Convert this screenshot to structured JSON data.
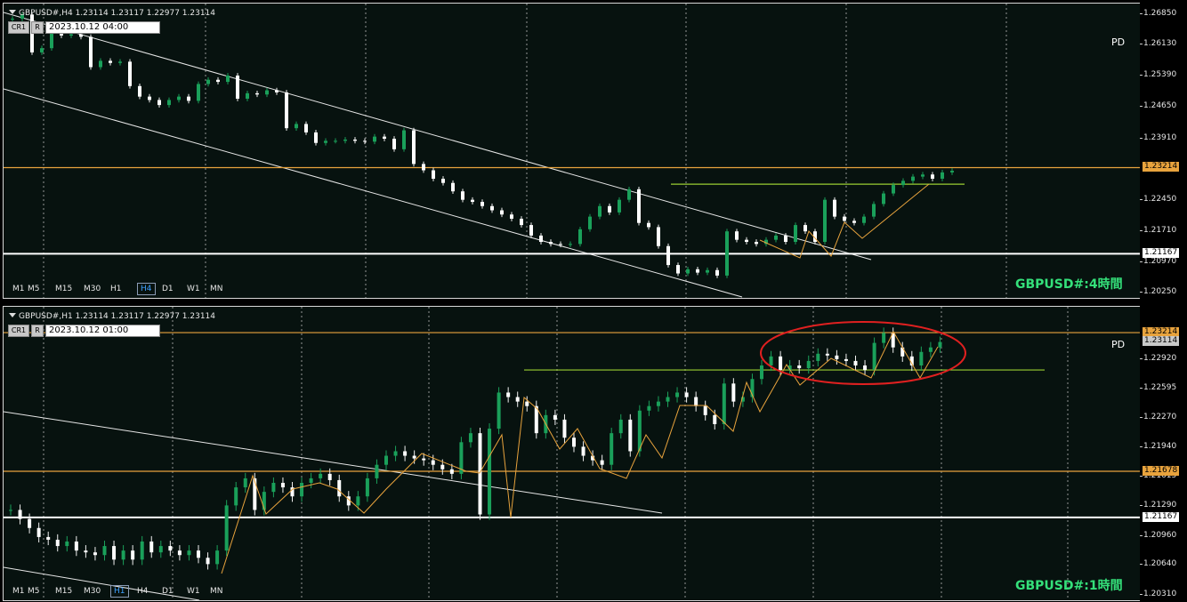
{
  "charts": [
    {
      "header": "GBPUSD#,H4  1.23114 1.23117 1.22977 1.23114",
      "btn1": "CR1",
      "btn2": "R",
      "date": "2023.10.12 04:00",
      "pd": "PD",
      "caption": "GBPUSD#:4時間",
      "timeframes": [
        "M1",
        "M5",
        "M15",
        "M30",
        "H1",
        "H4",
        "D1",
        "W1",
        "MN"
      ],
      "active_tf": "H4",
      "price_labels": [
        {
          "text": "1.23214",
          "value": 1.23214,
          "color": "#e8a33d"
        },
        {
          "text": "1.21167",
          "value": 1.21167,
          "color": "#ffffff"
        }
      ]
    },
    {
      "header": "GBPUSD#,H1  1.23114 1.23117 1.22977 1.23114",
      "btn1": "CR1",
      "btn2": "R",
      "date": "2023.10.12 01:00",
      "pd": "PD",
      "caption": "GBPUSD#:1時間",
      "timeframes": [
        "M1",
        "M5",
        "M15",
        "M30",
        "H1",
        "H4",
        "D1",
        "W1",
        "MN"
      ],
      "active_tf": "H1",
      "price_labels": [
        {
          "text": "1.23214",
          "value": 1.23214,
          "color": "#e8a33d"
        },
        {
          "text": "1.23114",
          "value": 1.23114,
          "color": "#c9c9c9"
        },
        {
          "text": "1.21678",
          "value": 1.21678,
          "color": "#e8a33d"
        },
        {
          "text": "1.21167",
          "value": 1.21167,
          "color": "#ffffff"
        }
      ]
    }
  ],
  "chart_data": [
    {
      "type": "candlestick",
      "symbol": "GBPUSD#",
      "timeframe": "H4",
      "bid": "1.23114",
      "y_ticks": [
        "1.26850",
        "1.26130",
        "1.25390",
        "1.24650",
        "1.23910",
        "1.22450",
        "1.21710",
        "1.20970",
        "1.20250"
      ],
      "ylim": [
        1.2012,
        1.2711
      ],
      "horizontal_lines": [
        {
          "price": 1.23214,
          "color": "#e8a33d"
        },
        {
          "price": 1.21167,
          "color": "#ffffff"
        },
        {
          "price": 1.2282,
          "color": "#9acd32"
        }
      ],
      "closes": [
        1.2675,
        1.2685,
        1.2595,
        1.2605,
        1.2645,
        1.2635,
        1.2638,
        1.2632,
        1.256,
        1.2575,
        1.257,
        1.2573,
        1.2515,
        1.249,
        1.2482,
        1.247,
        1.2482,
        1.249,
        1.248,
        1.252,
        1.253,
        1.2525,
        1.254,
        1.2485,
        1.2498,
        1.2495,
        1.2505,
        1.25,
        1.2415,
        1.2425,
        1.2405,
        1.238,
        1.2385,
        1.2385,
        1.2388,
        1.2385,
        1.2383,
        1.2395,
        1.239,
        1.2365,
        1.241,
        1.233,
        1.2315,
        1.2295,
        1.2285,
        1.2265,
        1.2245,
        1.224,
        1.223,
        1.222,
        1.221,
        1.22,
        1.2185,
        1.216,
        1.2145,
        1.214,
        1.2138,
        1.214,
        1.2175,
        1.2205,
        1.223,
        1.2215,
        1.2245,
        1.227,
        1.219,
        1.218,
        1.2135,
        1.209,
        1.207,
        1.208,
        1.2072,
        1.2078,
        1.2065,
        1.217,
        1.215,
        1.2145,
        1.214,
        1.215,
        1.216,
        1.2145,
        1.2185,
        1.217,
        1.2145,
        1.2245,
        1.2205,
        1.2195,
        1.219,
        1.2205,
        1.2235,
        1.226,
        1.228,
        1.229,
        1.23,
        1.2305,
        1.2295,
        1.231,
        1.2314
      ]
    },
    {
      "type": "candlestick",
      "symbol": "GBPUSD#",
      "timeframe": "H1",
      "bid": "1.23114",
      "y_ticks": [
        "1.22920",
        "1.22595",
        "1.22270",
        "1.21940",
        "1.21615",
        "1.21290",
        "1.20960",
        "1.20640",
        "1.20310"
      ],
      "ylim": [
        1.2025,
        1.235
      ],
      "horizontal_lines": [
        {
          "price": 1.23214,
          "color": "#e8a33d"
        },
        {
          "price": 1.21678,
          "color": "#e8a33d"
        },
        {
          "price": 1.21167,
          "color": "#ffffff"
        },
        {
          "price": 1.228,
          "color": "#9acd32"
        }
      ],
      "closes": [
        1.2125,
        1.2115,
        1.2105,
        1.2095,
        1.2092,
        1.2085,
        1.209,
        1.208,
        1.2078,
        1.2075,
        1.2085,
        1.207,
        1.208,
        1.207,
        1.209,
        1.2078,
        1.2085,
        1.208,
        1.2075,
        1.208,
        1.2072,
        1.2065,
        1.208,
        1.213,
        1.215,
        1.216,
        1.2125,
        1.2145,
        1.2155,
        1.215,
        1.214,
        1.2155,
        1.216,
        1.2165,
        1.2158,
        1.214,
        1.213,
        1.214,
        1.216,
        1.2175,
        1.2185,
        1.219,
        1.2185,
        1.2182,
        1.218,
        1.2175,
        1.217,
        1.2165,
        1.22,
        1.221,
        1.212,
        1.2215,
        1.2255,
        1.225,
        1.2245,
        1.224,
        1.221,
        1.223,
        1.2225,
        1.2205,
        1.2195,
        1.2185,
        1.218,
        1.2175,
        1.221,
        1.2225,
        1.219,
        1.2235,
        1.224,
        1.2245,
        1.225,
        1.2255,
        1.225,
        1.224,
        1.223,
        1.222,
        1.2265,
        1.2245,
        1.225,
        1.227,
        1.2285,
        1.2295,
        1.228,
        1.2285,
        1.2282,
        1.229,
        1.2298,
        1.2296,
        1.2292,
        1.229,
        1.2285,
        1.228,
        1.231,
        1.2321,
        1.2305,
        1.2295,
        1.2285,
        1.23,
        1.2305,
        1.2311
      ]
    }
  ]
}
